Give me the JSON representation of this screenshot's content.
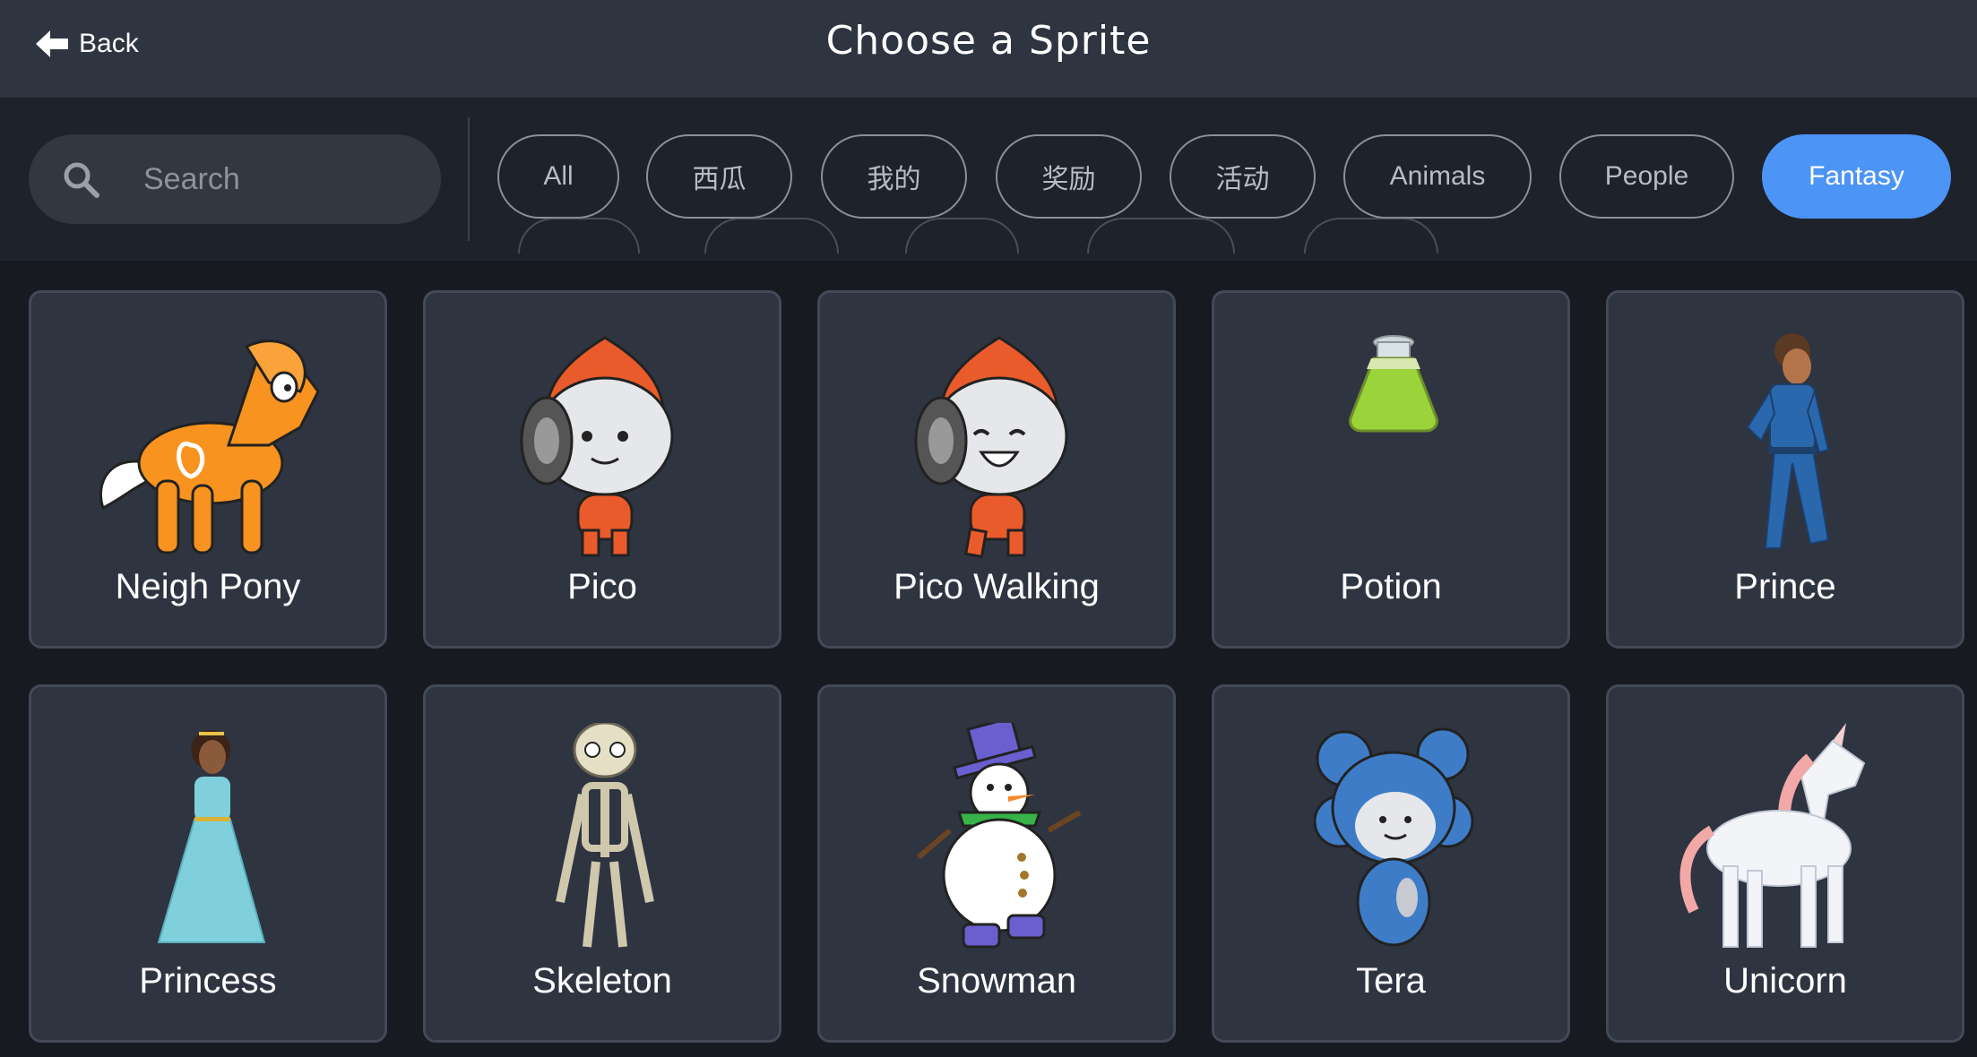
{
  "header": {
    "back_label": "Back",
    "title": "Choose a Sprite"
  },
  "search": {
    "placeholder": "Search",
    "value": ""
  },
  "filters": [
    {
      "label": "All",
      "active": false
    },
    {
      "label": "西瓜",
      "active": false
    },
    {
      "label": "我的",
      "active": false
    },
    {
      "label": "奖励",
      "active": false
    },
    {
      "label": "活动",
      "active": false
    },
    {
      "label": "Animals",
      "active": false
    },
    {
      "label": "People",
      "active": false
    },
    {
      "label": "Fantasy",
      "active": true
    }
  ],
  "sprites": [
    {
      "name": "Neigh Pony",
      "icon": "pony-icon"
    },
    {
      "name": "Pico",
      "icon": "pico-icon"
    },
    {
      "name": "Pico Walking",
      "icon": "pico-walking-icon"
    },
    {
      "name": "Potion",
      "icon": "potion-icon"
    },
    {
      "name": "Prince",
      "icon": "prince-icon"
    },
    {
      "name": "Princess",
      "icon": "princess-icon"
    },
    {
      "name": "Skeleton",
      "icon": "skeleton-icon"
    },
    {
      "name": "Snowman",
      "icon": "snowman-icon"
    },
    {
      "name": "Tera",
      "icon": "tera-icon"
    },
    {
      "name": "Unicorn",
      "icon": "unicorn-icon"
    }
  ],
  "colors": {
    "header_bg": "#2f3441",
    "toolbar_bg": "#1e222b",
    "page_bg": "#171a21",
    "card_bg": "#2f3441",
    "accent": "#4d94f7"
  }
}
